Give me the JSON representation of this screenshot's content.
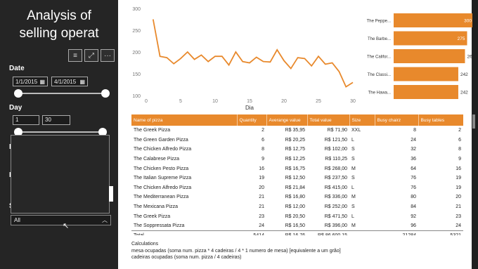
{
  "sidebar": {
    "title": "Analysis of selling operat",
    "toolbar": [
      "≡",
      "⤢",
      "···"
    ],
    "date_label": "Date",
    "date_from": "1/1/2015",
    "date_to": "4/1/2015",
    "day_label": "Day",
    "day_from": "1",
    "day_to": "30",
    "dropdown_value": "All",
    "partial_labels": [
      "P",
      "P",
      "S"
    ]
  },
  "chart_data": [
    {
      "type": "line",
      "xlabel": "Dia",
      "ylabel": "",
      "xlim": [
        0,
        30
      ],
      "ylim": [
        100,
        300
      ],
      "x_ticks": [
        "0",
        "5",
        "10",
        "15",
        "20",
        "25",
        "30"
      ],
      "y_ticks": [
        "100",
        "150",
        "200",
        "250",
        "300"
      ],
      "color": "#e8892c",
      "x": [
        1,
        2,
        3,
        4,
        5,
        6,
        7,
        8,
        9,
        10,
        11,
        12,
        13,
        14,
        15,
        16,
        17,
        18,
        19,
        20,
        21,
        22,
        23,
        24,
        25,
        26,
        27,
        28,
        29,
        30
      ],
      "y": [
        275,
        190,
        187,
        173,
        185,
        200,
        183,
        193,
        178,
        190,
        190,
        170,
        200,
        178,
        175,
        188,
        178,
        177,
        205,
        180,
        162,
        187,
        185,
        168,
        190,
        172,
        175,
        155,
        120,
        130
      ]
    },
    {
      "type": "bar",
      "orientation": "horizontal",
      "color": "#e8892c",
      "categories": [
        "The Peppe...",
        "The Barbe...",
        "The Califor...",
        "The Classi...",
        "The Hawa..."
      ],
      "values": [
        300,
        275,
        267,
        242,
        242
      ]
    }
  ],
  "table": {
    "columns": [
      "Name of pizza",
      "Quantity",
      "Averange value",
      "Total value",
      "Size",
      "Busy chairz",
      "Busy tables"
    ],
    "rows": [
      [
        "The Greek Pizza",
        "2",
        "R$ 35,95",
        "R$ 71,90",
        "XXL",
        "8",
        "2"
      ],
      [
        "The Green Garden Pizza",
        "6",
        "R$ 20,25",
        "R$ 121,50",
        "L",
        "24",
        "6"
      ],
      [
        "The Chicken Alfredo Pizza",
        "8",
        "R$ 12,75",
        "R$ 102,00",
        "S",
        "32",
        "8"
      ],
      [
        "The Calabrese Pizza",
        "9",
        "R$ 12,25",
        "R$ 110,25",
        "S",
        "36",
        "9"
      ],
      [
        "The Chicken Pesto Pizza",
        "16",
        "R$ 16,75",
        "R$ 268,00",
        "M",
        "64",
        "16"
      ],
      [
        "The Italian Supreme Pizza",
        "19",
        "R$ 12,50",
        "R$ 237,50",
        "S",
        "76",
        "19"
      ],
      [
        "The Chicken Alfredo Pizza",
        "20",
        "R$ 21,84",
        "R$ 415,00",
        "L",
        "76",
        "19"
      ],
      [
        "The Mediterranean Pizza",
        "21",
        "R$ 16,80",
        "R$ 336,00",
        "M",
        "80",
        "20"
      ],
      [
        "The Mexicana Pizza",
        "21",
        "R$ 12,00",
        "R$ 252,00",
        "S",
        "84",
        "21"
      ],
      [
        "The Greek Pizza",
        "23",
        "R$ 20,50",
        "R$ 471,50",
        "L",
        "92",
        "23"
      ],
      [
        "The Soppressata Pizza",
        "24",
        "R$ 16,50",
        "R$ 396,00",
        "M",
        "96",
        "24"
      ]
    ],
    "total": [
      "Total",
      "5414",
      "R$ 16,76",
      "R$ 86.600,15",
      "",
      "21284",
      "5321"
    ]
  },
  "calculations": {
    "title": "Calculations",
    "line1": "mesa ocupadas (soma num. pizza * 4 cadeiras / 4 * 1 numero de mesa) [equivalente a um grão]",
    "line2": "cadeiras ocupadas (soma num. pizza / 4 cadeiras)"
  }
}
